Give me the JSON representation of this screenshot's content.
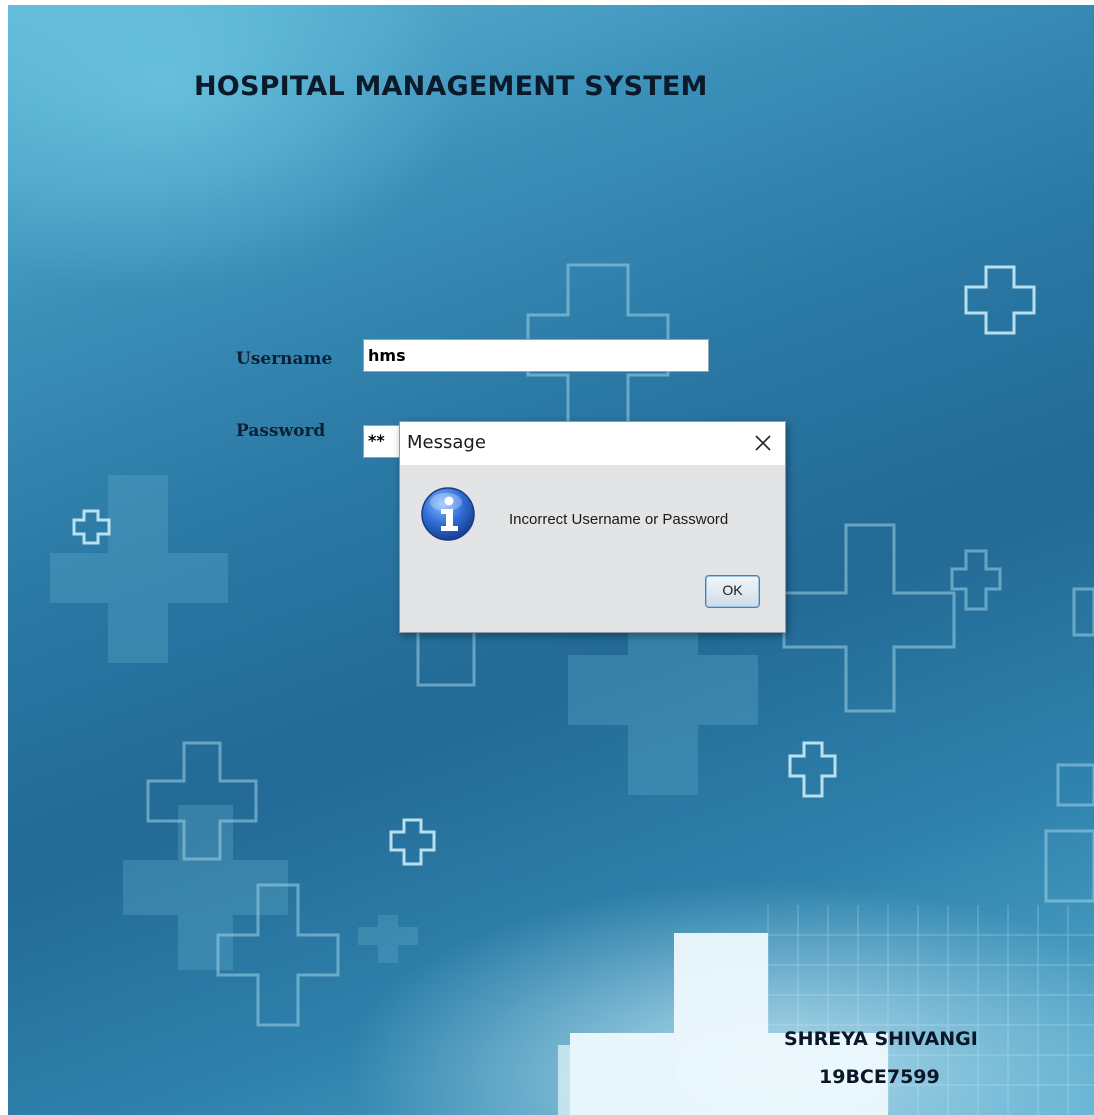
{
  "app": {
    "title": "HOSPITAL MANAGEMENT SYSTEM",
    "username_label": "Username",
    "password_label": "Password",
    "username_value": "hms",
    "password_value": "**"
  },
  "credits": {
    "name": "SHREYA SHIVANGI",
    "id": "19BCE7599"
  },
  "dialog": {
    "title": "Message",
    "message": "Incorrect Username or Password",
    "ok_label": "OK",
    "icon": "info-icon"
  }
}
